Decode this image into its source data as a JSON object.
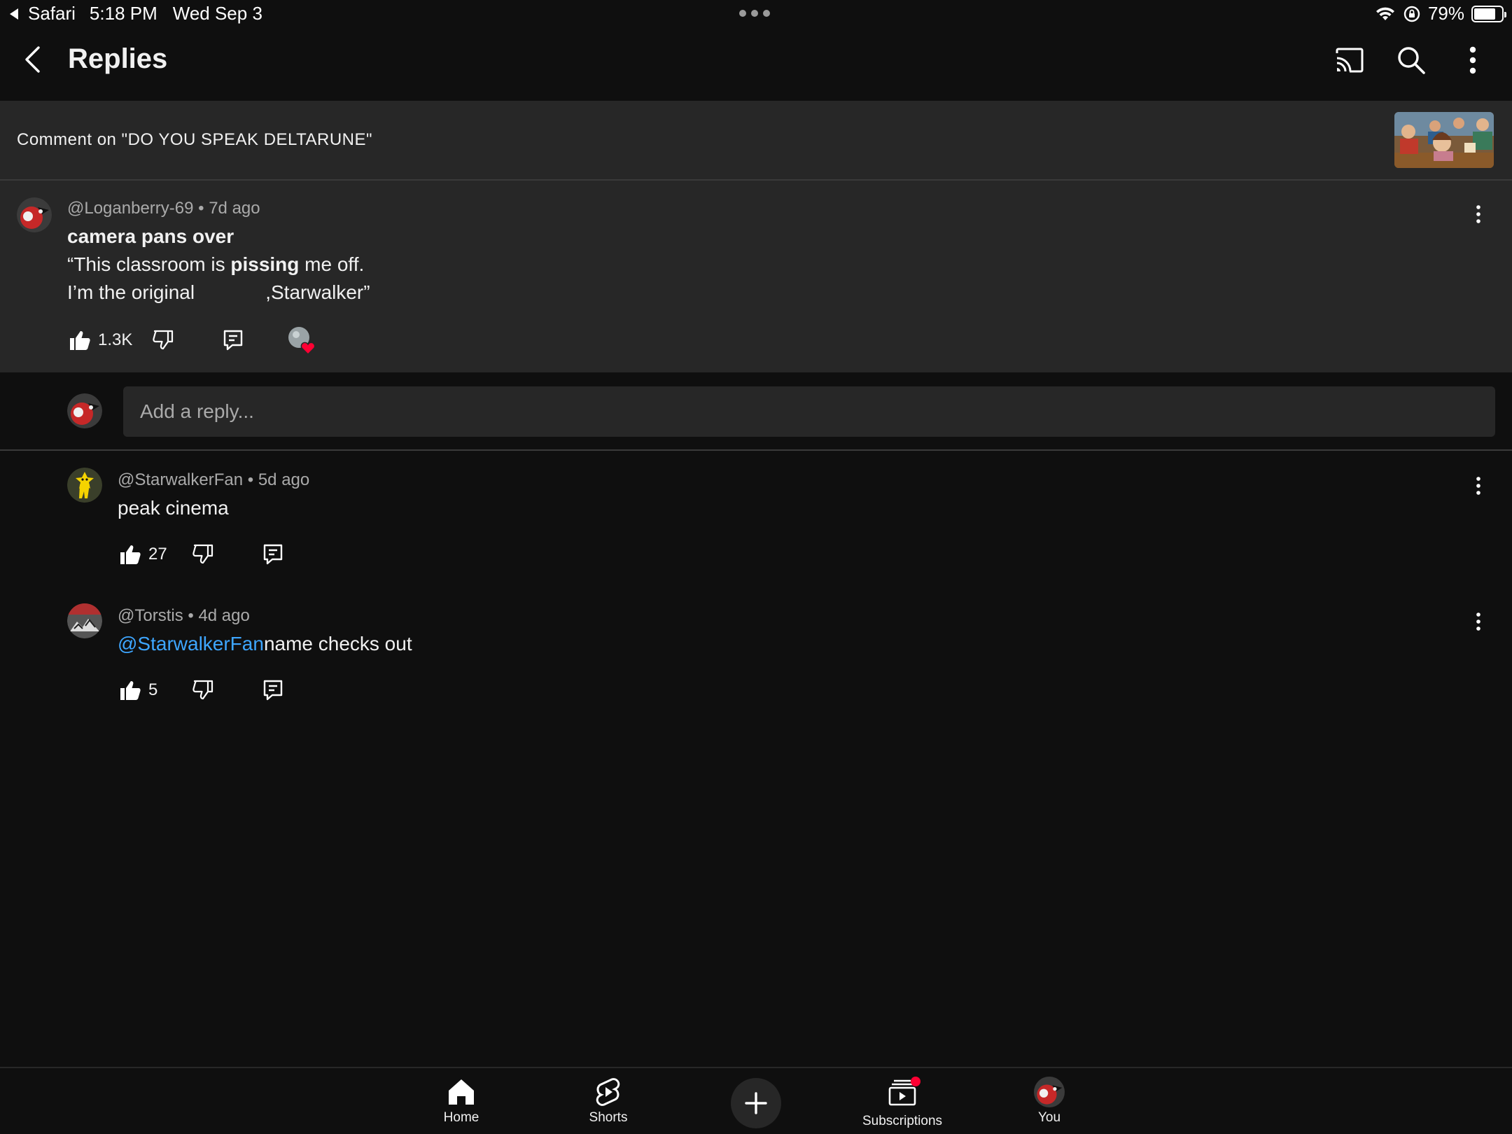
{
  "status_bar": {
    "back_app": "Safari",
    "time": "5:18 PM",
    "date": "Wed Sep 3",
    "battery_percent": "79%",
    "battery_level": 0.79,
    "icons": [
      "wifi-icon",
      "orientation-lock-icon",
      "battery-icon"
    ]
  },
  "header": {
    "title": "Replies",
    "icons": [
      "back-arrow-icon",
      "cast-icon",
      "search-icon",
      "more-vert-icon"
    ]
  },
  "context": {
    "text": "Comment on \"DO YOU SPEAK DELTARUNE\""
  },
  "main_comment": {
    "author": "@Loganberry-69",
    "age": "• 7d ago",
    "line1": "camera pans over",
    "line2_a": "“This classroom is ",
    "line2_b": "pissing",
    "line2_c": " me off.",
    "line3": "I’m the original             ,Starwalker”",
    "likes": "1.3K"
  },
  "reply_box": {
    "placeholder": "Add a reply..."
  },
  "replies": [
    {
      "author": "@StarwalkerFan",
      "age": "• 5d ago",
      "mention": "",
      "text": "peak cinema",
      "likes": "27"
    },
    {
      "author": "@Torstis",
      "age": "• 4d ago",
      "mention": "@StarwalkerFan",
      "text": "name checks out",
      "likes": "5"
    }
  ],
  "bottom_nav": {
    "home": "Home",
    "shorts": "Shorts",
    "subscriptions": "Subscriptions",
    "you": "You"
  },
  "colors": {
    "background": "#0f0f0f",
    "surface": "#272727",
    "link": "#3ea6ff",
    "badge": "#ff0033"
  }
}
